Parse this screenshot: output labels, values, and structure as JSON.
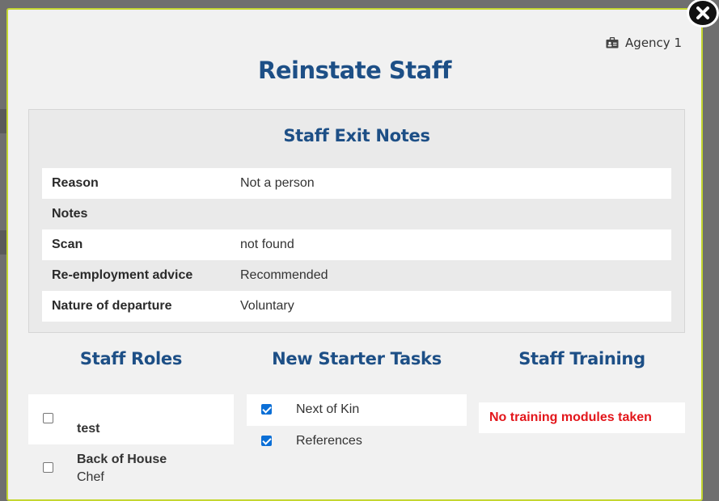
{
  "agency": {
    "name": "Agency 1",
    "icon": "id-card-icon"
  },
  "modal": {
    "title": "Reinstate Staff",
    "close_icon": "close-icon"
  },
  "exit_notes": {
    "title": "Staff Exit Notes",
    "rows": [
      {
        "label": "Reason",
        "value": "Not a person"
      },
      {
        "label": "Notes",
        "value": ""
      },
      {
        "label": "Scan",
        "value": "not found"
      },
      {
        "label": "Re-employment advice",
        "value": "Recommended"
      },
      {
        "label": "Nature of departure",
        "value": "Voluntary"
      }
    ]
  },
  "roles": {
    "title": "Staff Roles",
    "items": [
      {
        "name": "test",
        "sub": "",
        "checked": false
      },
      {
        "name": "Back of House",
        "sub": "Chef",
        "checked": false
      }
    ]
  },
  "tasks": {
    "title": "New Starter Tasks",
    "items": [
      {
        "label": "Next of Kin",
        "checked": true
      },
      {
        "label": "References",
        "checked": true
      }
    ]
  },
  "training": {
    "title": "Staff Training",
    "empty_message": "No training modules taken",
    "empty_color": "#e3161b"
  },
  "colors": {
    "heading": "#1d4f86",
    "modal_border": "#c4d630",
    "checkbox_checked": "#0b6fd6"
  }
}
